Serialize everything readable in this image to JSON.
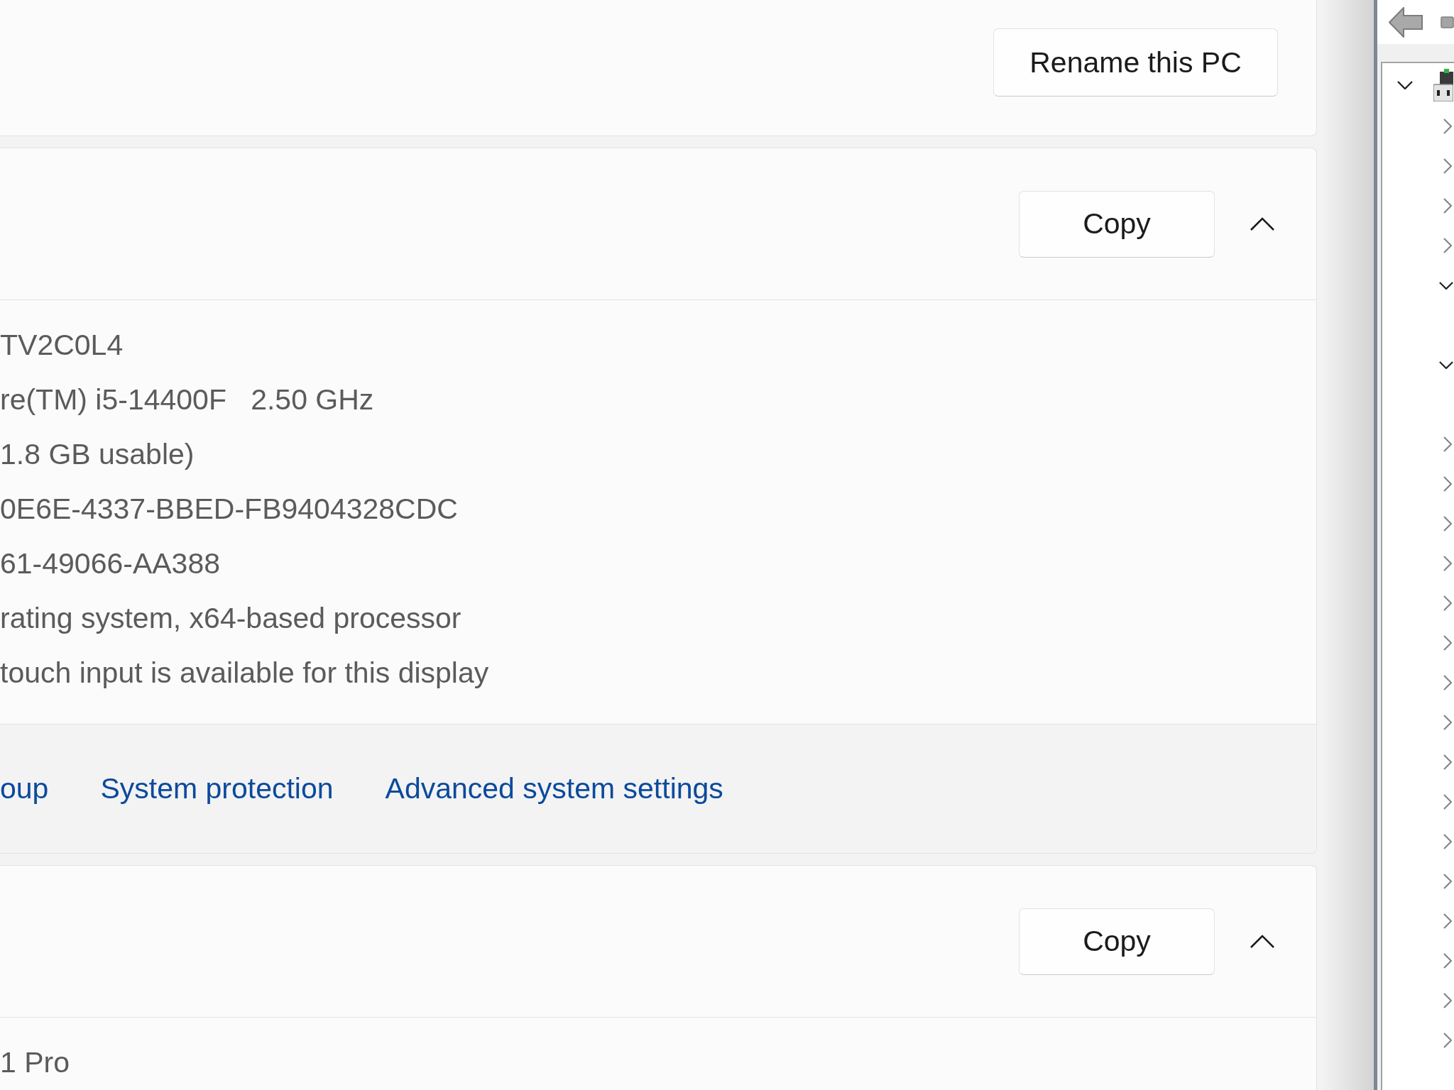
{
  "rename_card": {
    "button": "Rename this PC"
  },
  "sections": [
    {
      "copy_button": "Copy",
      "expanded": true,
      "values": [
        "TV2C0L4",
        "re(TM) i5-14400F   2.50 GHz",
        "1.8 GB usable)",
        "0E6E-4337-BBED-FB9404328CDC",
        "61-49066-AA388",
        "rating system, x64-based processor",
        "touch input is available for this display"
      ],
      "links": [
        "oup",
        "System protection",
        "Advanced system settings"
      ]
    },
    {
      "copy_button": "Copy",
      "expanded": true,
      "values": [
        "1 Pro"
      ]
    }
  ],
  "device_manager": {
    "tree": [
      {
        "kind": "computer",
        "expanded": true,
        "children": [
          {
            "kind": "category",
            "expanded": false
          },
          {
            "kind": "category",
            "expanded": false
          },
          {
            "kind": "category",
            "expanded": false
          },
          {
            "kind": "category",
            "expanded": false
          },
          {
            "kind": "category",
            "expanded": true,
            "children": [
              {
                "kind": "device"
              }
            ]
          },
          {
            "kind": "category",
            "expanded": true,
            "children": [
              {
                "kind": "device"
              }
            ]
          },
          {
            "kind": "category",
            "expanded": false
          },
          {
            "kind": "category",
            "expanded": false
          },
          {
            "kind": "category",
            "expanded": false
          },
          {
            "kind": "category",
            "expanded": false
          },
          {
            "kind": "category",
            "expanded": false
          },
          {
            "kind": "category",
            "expanded": false
          },
          {
            "kind": "category",
            "expanded": false
          },
          {
            "kind": "category",
            "expanded": false
          },
          {
            "kind": "category",
            "expanded": false
          },
          {
            "kind": "category",
            "expanded": false
          },
          {
            "kind": "category",
            "expanded": false
          },
          {
            "kind": "category",
            "expanded": false
          },
          {
            "kind": "category",
            "expanded": false
          },
          {
            "kind": "category",
            "expanded": false
          },
          {
            "kind": "category",
            "expanded": false
          },
          {
            "kind": "category",
            "expanded": false
          }
        ]
      }
    ]
  }
}
